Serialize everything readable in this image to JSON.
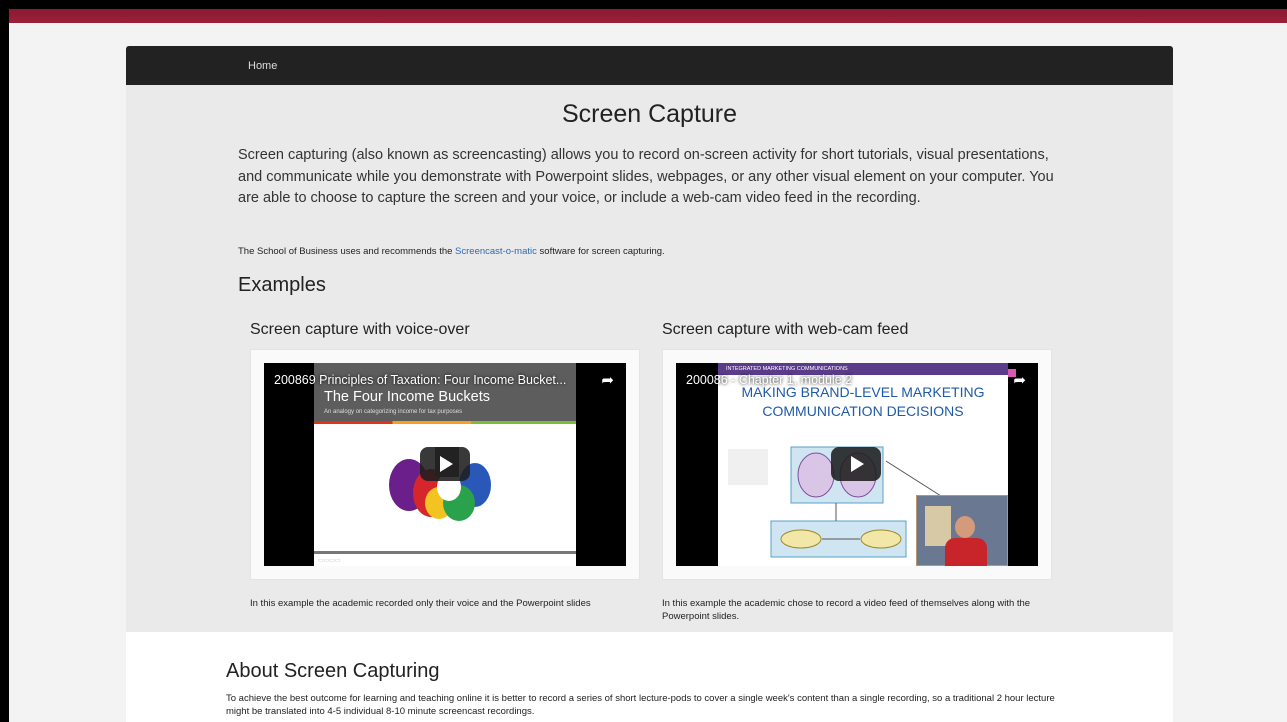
{
  "nav": {
    "home": "Home"
  },
  "page": {
    "title": "Screen Capture",
    "intro": "Screen capturing (also known as screencasting) allows you to record on-screen activity for short tutorials, visual presentations, and communicate while you demonstrate with Powerpoint slides, webpages, or any other visual element on your computer. You are able to choose to capture the screen and your voice, or include a web-cam video feed in the recording.",
    "note_prefix": "The School of Business uses and recommends the ",
    "note_link": "Screencast-o-matic",
    "note_suffix": " software for screen capturing."
  },
  "examples": {
    "heading": "Examples",
    "items": [
      {
        "heading": "Screen capture with voice-over",
        "video_title": "200869 Principles of Taxation: Four Income Bucket...",
        "slide_title": "The Four Income Buckets",
        "slide_subtitle": "An analogy on categorizing income for tax purposes",
        "caption": "In this example the academic recorded only their voice and the Powerpoint slides"
      },
      {
        "heading": "Screen capture with web-cam feed",
        "video_title": "200086 - Chapter 1, module 2",
        "slide_header": "INTEGRATED MARKETING COMMUNICATIONS",
        "slide_title": "MAKING BRAND-LEVEL MARKETING COMMUNICATION DECISIONS",
        "caption": "In this example the academic chose to record a video feed of themselves along with the Powerpoint slides."
      }
    ]
  },
  "about": {
    "heading": "About Screen Capturing",
    "text": "To achieve the best outcome for learning and teaching online it is better to record a series of short lecture-pods to cover a single week's content than a single recording, so a traditional 2 hour lecture might be translated into 4-5 individual 8-10 minute screencast recordings."
  },
  "icons": {
    "share": "share-arrow-icon",
    "play": "youtube-play-icon"
  },
  "colors": {
    "accent_bar": "#8b1a32",
    "navbar": "#222222",
    "link": "#2a6bb5"
  }
}
